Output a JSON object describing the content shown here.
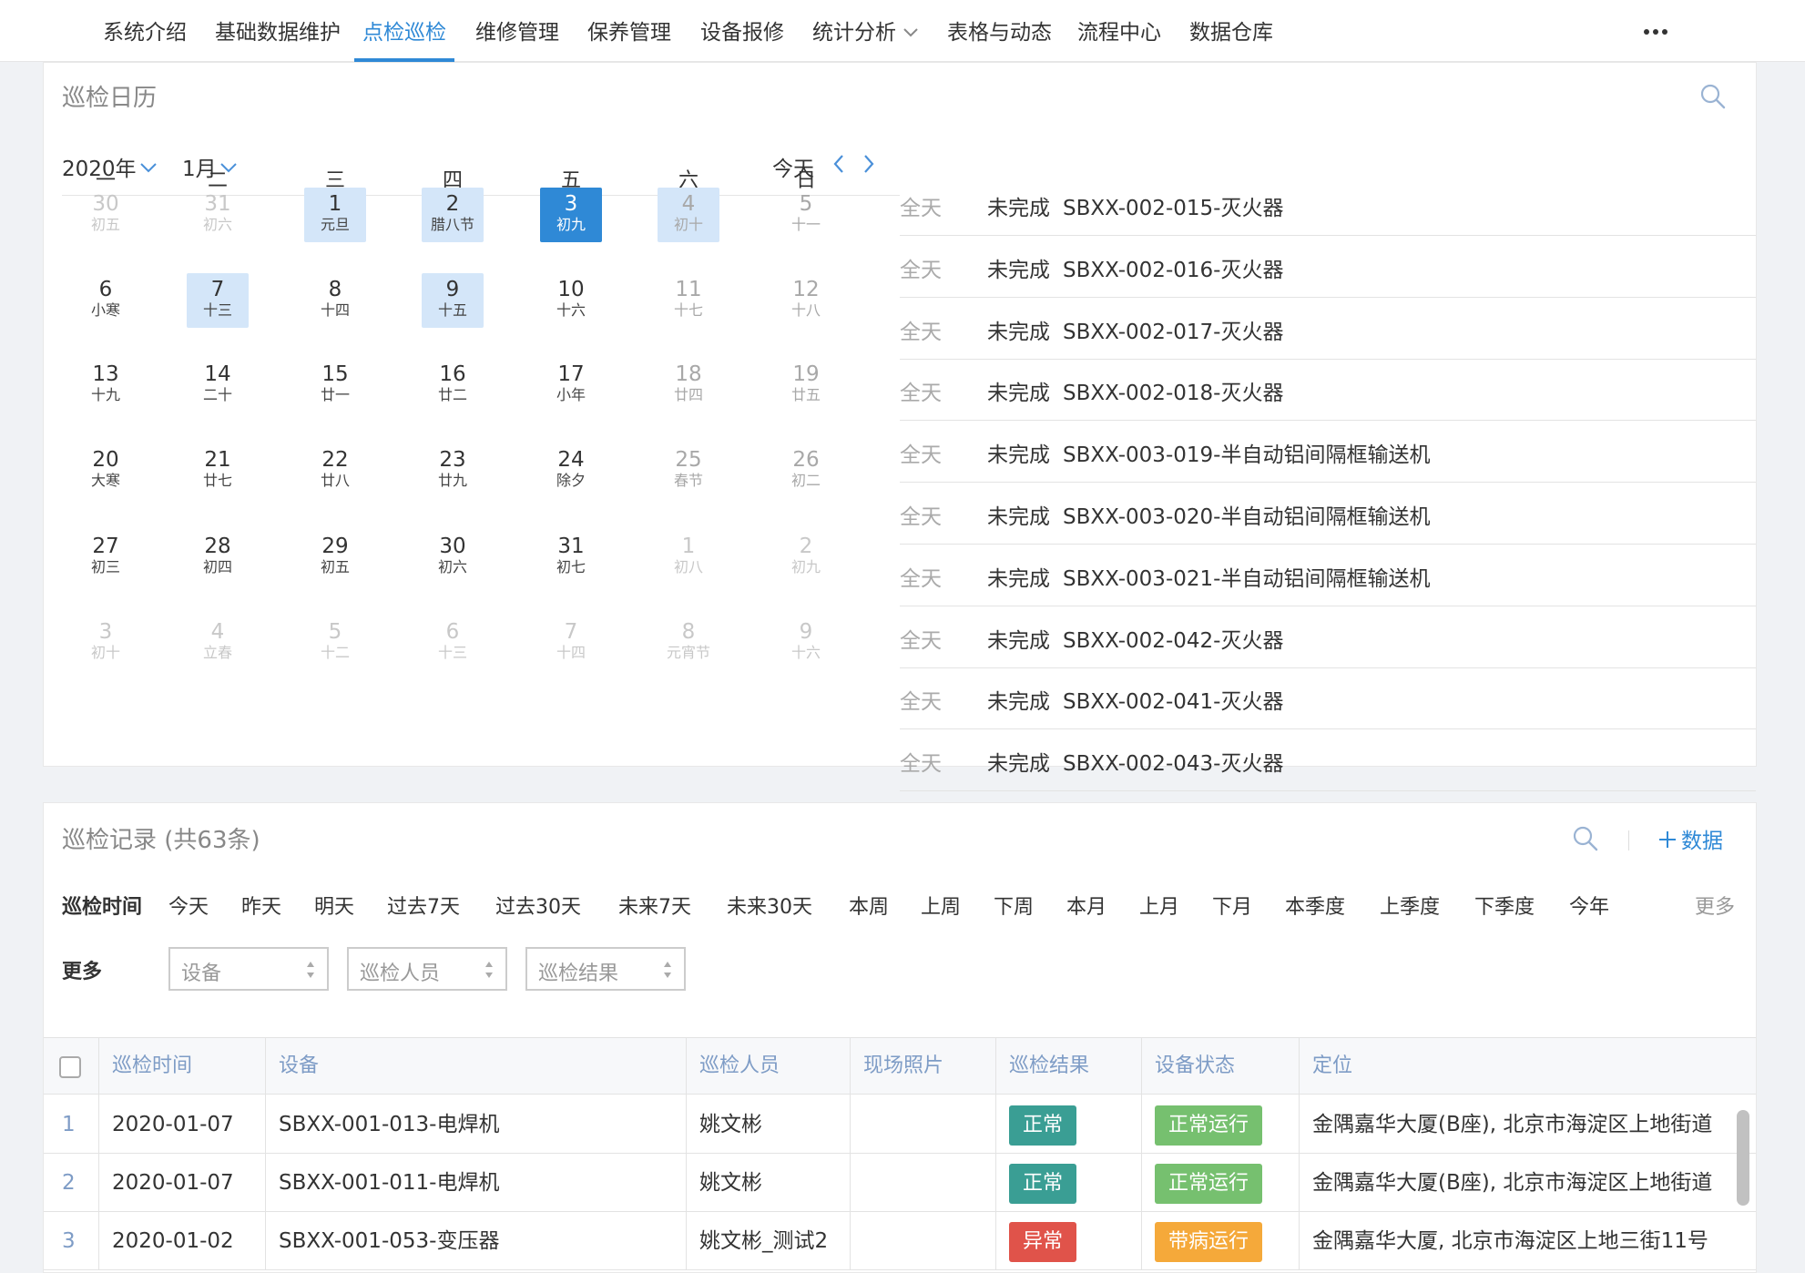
{
  "nav": {
    "items": [
      {
        "label": "系统介绍"
      },
      {
        "label": "基础数据维护"
      },
      {
        "label": "点检巡检",
        "active": true
      },
      {
        "label": "维修管理"
      },
      {
        "label": "保养管理"
      },
      {
        "label": "设备报修"
      },
      {
        "label": "统计分析",
        "has_dropdown": true
      },
      {
        "label": "表格与动态"
      },
      {
        "label": "流程中心"
      },
      {
        "label": "数据仓库"
      }
    ],
    "more_icon": "more-dots-icon"
  },
  "calendar": {
    "title": "巡检日历",
    "year_label": "2020年",
    "month_label": "1月",
    "today_label": "今天",
    "weekdays": [
      "一",
      "二",
      "三",
      "四",
      "五",
      "六",
      "日"
    ],
    "weeks": [
      [
        {
          "d": "30",
          "l": "初五",
          "state": "muted"
        },
        {
          "d": "31",
          "l": "初六",
          "state": "muted"
        },
        {
          "d": "1",
          "l": "元旦",
          "state": "light"
        },
        {
          "d": "2",
          "l": "腊八节",
          "state": "light"
        },
        {
          "d": "3",
          "l": "初九",
          "state": "selected"
        },
        {
          "d": "4",
          "l": "初十",
          "state": "light-weekend"
        },
        {
          "d": "5",
          "l": "十一",
          "state": "weekend"
        }
      ],
      [
        {
          "d": "6",
          "l": "小寒",
          "state": ""
        },
        {
          "d": "7",
          "l": "十三",
          "state": "light"
        },
        {
          "d": "8",
          "l": "十四",
          "state": ""
        },
        {
          "d": "9",
          "l": "十五",
          "state": "light"
        },
        {
          "d": "10",
          "l": "十六",
          "state": ""
        },
        {
          "d": "11",
          "l": "十七",
          "state": "weekend"
        },
        {
          "d": "12",
          "l": "十八",
          "state": "weekend"
        }
      ],
      [
        {
          "d": "13",
          "l": "十九",
          "state": ""
        },
        {
          "d": "14",
          "l": "二十",
          "state": ""
        },
        {
          "d": "15",
          "l": "廿一",
          "state": ""
        },
        {
          "d": "16",
          "l": "廿二",
          "state": ""
        },
        {
          "d": "17",
          "l": "小年",
          "state": ""
        },
        {
          "d": "18",
          "l": "廿四",
          "state": "weekend"
        },
        {
          "d": "19",
          "l": "廿五",
          "state": "weekend"
        }
      ],
      [
        {
          "d": "20",
          "l": "大寒",
          "state": ""
        },
        {
          "d": "21",
          "l": "廿七",
          "state": ""
        },
        {
          "d": "22",
          "l": "廿八",
          "state": ""
        },
        {
          "d": "23",
          "l": "廿九",
          "state": ""
        },
        {
          "d": "24",
          "l": "除夕",
          "state": ""
        },
        {
          "d": "25",
          "l": "春节",
          "state": "weekend"
        },
        {
          "d": "26",
          "l": "初二",
          "state": "weekend"
        }
      ],
      [
        {
          "d": "27",
          "l": "初三",
          "state": ""
        },
        {
          "d": "28",
          "l": "初四",
          "state": ""
        },
        {
          "d": "29",
          "l": "初五",
          "state": ""
        },
        {
          "d": "30",
          "l": "初六",
          "state": ""
        },
        {
          "d": "31",
          "l": "初七",
          "state": ""
        },
        {
          "d": "1",
          "l": "初八",
          "state": "muted"
        },
        {
          "d": "2",
          "l": "初九",
          "state": "muted"
        }
      ],
      [
        {
          "d": "3",
          "l": "初十",
          "state": "muted"
        },
        {
          "d": "4",
          "l": "立春",
          "state": "muted"
        },
        {
          "d": "5",
          "l": "十二",
          "state": "muted"
        },
        {
          "d": "6",
          "l": "十三",
          "state": "muted"
        },
        {
          "d": "7",
          "l": "十四",
          "state": "muted"
        },
        {
          "d": "8",
          "l": "元宵节",
          "state": "muted"
        },
        {
          "d": "9",
          "l": "十六",
          "state": "muted"
        }
      ]
    ],
    "events": [
      {
        "allday": "全天",
        "status": "未完成",
        "name": "SBXX-002-015-灭火器"
      },
      {
        "allday": "全天",
        "status": "未完成",
        "name": "SBXX-002-016-灭火器"
      },
      {
        "allday": "全天",
        "status": "未完成",
        "name": "SBXX-002-017-灭火器"
      },
      {
        "allday": "全天",
        "status": "未完成",
        "name": "SBXX-002-018-灭火器"
      },
      {
        "allday": "全天",
        "status": "未完成",
        "name": "SBXX-003-019-半自动铝间隔框输送机"
      },
      {
        "allday": "全天",
        "status": "未完成",
        "name": "SBXX-003-020-半自动铝间隔框输送机"
      },
      {
        "allday": "全天",
        "status": "未完成",
        "name": "SBXX-003-021-半自动铝间隔框输送机"
      },
      {
        "allday": "全天",
        "status": "未完成",
        "name": "SBXX-002-042-灭火器"
      },
      {
        "allday": "全天",
        "status": "未完成",
        "name": "SBXX-002-041-灭火器"
      },
      {
        "allday": "全天",
        "status": "未完成",
        "name": "SBXX-002-043-灭火器"
      }
    ]
  },
  "records": {
    "title": "巡检记录 (共63条)",
    "add_label": "数据",
    "time_filter_label": "巡检时间",
    "time_options": [
      "今天",
      "昨天",
      "明天",
      "过去7天",
      "过去30天",
      "未来7天",
      "未来30天",
      "本周",
      "上周",
      "下周",
      "本月",
      "上月",
      "下月",
      "本季度",
      "上季度",
      "下季度",
      "今年"
    ],
    "more_link": "更多",
    "more_filter_label": "更多",
    "select_placeholders": [
      "设备",
      "巡检人员",
      "巡检结果"
    ],
    "columns": [
      "巡检时间",
      "设备",
      "巡检人员",
      "现场照片",
      "巡检结果",
      "设备状态",
      "定位"
    ],
    "rows": [
      {
        "idx": "1",
        "time": "2020-01-07",
        "device": "SBXX-001-013-电焊机",
        "person": "姚文彬",
        "photo": "",
        "result": "正常",
        "result_color": "#3a9e94",
        "state": "正常运行",
        "state_color": "#76c06f",
        "location": "金隅嘉华大厦(B座), 北京市海淀区上地街道"
      },
      {
        "idx": "2",
        "time": "2020-01-07",
        "device": "SBXX-001-011-电焊机",
        "person": "姚文彬",
        "photo": "",
        "result": "正常",
        "result_color": "#3a9e94",
        "state": "正常运行",
        "state_color": "#76c06f",
        "location": "金隅嘉华大厦(B座), 北京市海淀区上地街道"
      },
      {
        "idx": "3",
        "time": "2020-01-02",
        "device": "SBXX-001-053-变压器",
        "person": "姚文彬_测试2",
        "photo": "",
        "result": "异常",
        "result_color": "#e0534a",
        "state": "带病运行",
        "state_color": "#f5a93a",
        "location": "金隅嘉华大厦, 北京市海淀区上地三街11号"
      }
    ]
  },
  "colors": {
    "accent": "#2f89d6",
    "light_day": "#d4e6f9",
    "header_text": "#7e9cc6"
  }
}
